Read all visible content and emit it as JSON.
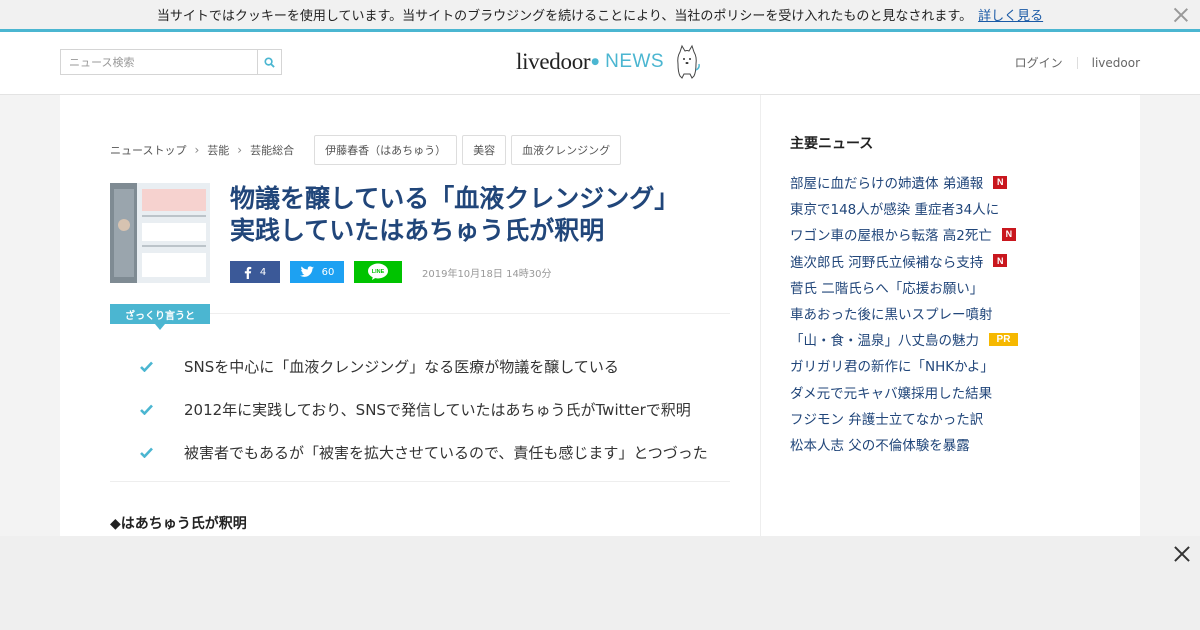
{
  "cookie_bar": {
    "message": "当サイトではクッキーを使用しています。当サイトのブラウジングを続けることにより、当社のポリシーを受け入れたものと見なされます。",
    "link_label": "詳しく見る"
  },
  "header": {
    "search_placeholder": "ニュース検索",
    "logo_main": "livedoor",
    "logo_news": "NEWS",
    "login_label": "ログイン",
    "livedoor_label": "livedoor"
  },
  "breadcrumb": {
    "items": [
      "ニューストップ",
      "芸能",
      "芸能総合"
    ],
    "tags": [
      "伊藤春香（はあちゅう）",
      "美容",
      "血液クレンジング"
    ]
  },
  "article": {
    "title_line1": "物議を醸している「血液クレンジング」",
    "title_line2": "実践していたはあちゅう氏が釈明",
    "share": {
      "facebook_count": "4",
      "twitter_count": "60",
      "line_label": "LINE"
    },
    "date": "2019年10月18日 14時30分",
    "summary_label": "ざっくり言うと",
    "summary": [
      "SNSを中心に「血液クレンジング」なる医療が物議を醸している",
      "2012年に実践しており、SNSで発信していたはあちゅう氏がTwitterで釈明",
      "被害者でもあるが「被害を拡大させているので、責任も感じます」とつづった"
    ],
    "section_heading": "◆はあちゅう氏が釈明"
  },
  "sidebar": {
    "title": "主要ニュース",
    "news": [
      {
        "text": "部屋に血だらけの姉遺体 弟通報",
        "badge": "N"
      },
      {
        "text": "東京で148人が感染 重症者34人に",
        "badge": ""
      },
      {
        "text": "ワゴン車の屋根から転落 高2死亡",
        "badge": "N"
      },
      {
        "text": "進次郎氏 河野氏立候補なら支持",
        "badge": "N"
      },
      {
        "text": "菅氏 二階氏らへ「応援お願い」",
        "badge": ""
      },
      {
        "text": "車あおった後に黒いスプレー噴射",
        "badge": ""
      },
      {
        "text": "「山・食・温泉」八丈島の魅力",
        "badge": "PR"
      },
      {
        "text": "ガリガリ君の新作に「NHKかよ」",
        "badge": ""
      },
      {
        "text": "ダメ元で元キャバ嬢採用した結果",
        "badge": ""
      },
      {
        "text": "フジモン 弁護士立てなかった訳",
        "badge": ""
      },
      {
        "text": "松本人志 父の不倫体験を暴露",
        "badge": ""
      }
    ]
  },
  "colors": {
    "accent": "#4bb6d1",
    "link": "#21467a",
    "facebook": "#3b5998",
    "twitter": "#1da1f2",
    "line": "#00c300",
    "badge_n": "#c9171e",
    "badge_pr": "#f6b800"
  }
}
